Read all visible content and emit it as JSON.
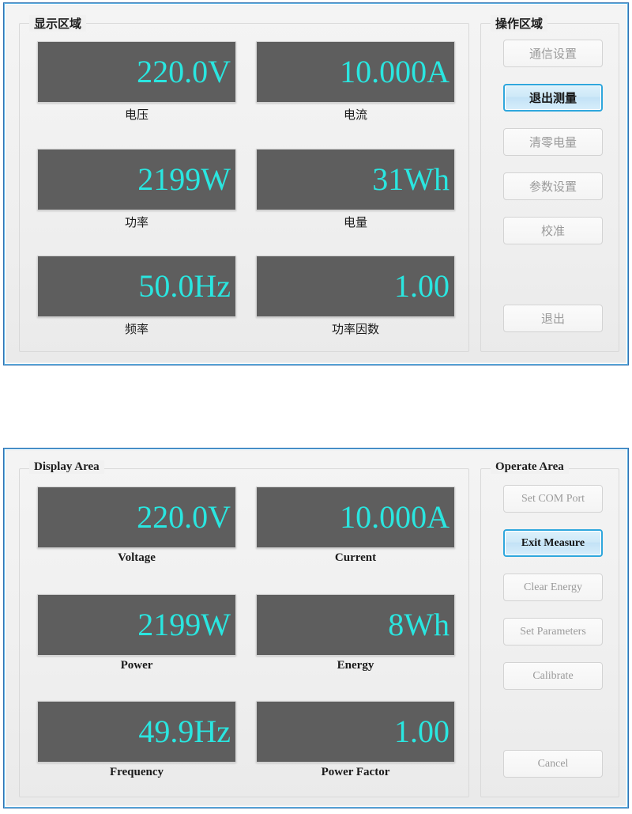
{
  "panels": [
    {
      "lang": "cn",
      "display_group_title": "显示区域",
      "operate_group_title": "操作区域",
      "meters": [
        {
          "value": "220.0V",
          "label": "电压"
        },
        {
          "value": "10.000A",
          "label": "电流"
        },
        {
          "value": "2199W",
          "label": "功率"
        },
        {
          "value": "31Wh",
          "label": "电量"
        },
        {
          "value": "50.0Hz",
          "label": "频率"
        },
        {
          "value": "1.00",
          "label": "功率因数"
        }
      ],
      "buttons": [
        {
          "label": "通信设置",
          "state": "disabled"
        },
        {
          "label": "退出测量",
          "state": "primary"
        },
        {
          "label": "清零电量",
          "state": "disabled"
        },
        {
          "label": "参数设置",
          "state": "disabled"
        },
        {
          "label": "校准",
          "state": "disabled"
        },
        {
          "label": "退出",
          "state": "disabled"
        }
      ]
    },
    {
      "lang": "en",
      "display_group_title": "Display Area",
      "operate_group_title": "Operate Area",
      "meters": [
        {
          "value": "220.0V",
          "label": "Voltage"
        },
        {
          "value": "10.000A",
          "label": "Current"
        },
        {
          "value": "2199W",
          "label": "Power"
        },
        {
          "value": "8Wh",
          "label": "Energy"
        },
        {
          "value": "49.9Hz",
          "label": "Frequency"
        },
        {
          "value": "1.00",
          "label": "Power Factor"
        }
      ],
      "buttons": [
        {
          "label": "Set COM Port",
          "state": "disabled"
        },
        {
          "label": "Exit Measure",
          "state": "primary"
        },
        {
          "label": "Clear Energy",
          "state": "disabled"
        },
        {
          "label": "Set Parameters",
          "state": "disabled"
        },
        {
          "label": "Calibrate",
          "state": "disabled"
        },
        {
          "label": "Cancel",
          "state": "disabled"
        }
      ]
    }
  ],
  "colors": {
    "window_border": "#2f6fb0",
    "window_border_inner": "#62b3e2",
    "panel_background": "#f1f1f1",
    "screen_background": "#5e5e5e",
    "value_text": "#2ae6e0",
    "primary_button_border": "#2fa7dd",
    "disabled_text": "#9a9a9a"
  },
  "geometry": {
    "meter_columns_x": [
      22,
      299
    ],
    "meter_column_width": 252,
    "meter_rows_y": [
      22,
      158,
      293
    ],
    "button_rows_y": [
      20,
      76,
      132,
      188,
      244,
      355
    ]
  }
}
